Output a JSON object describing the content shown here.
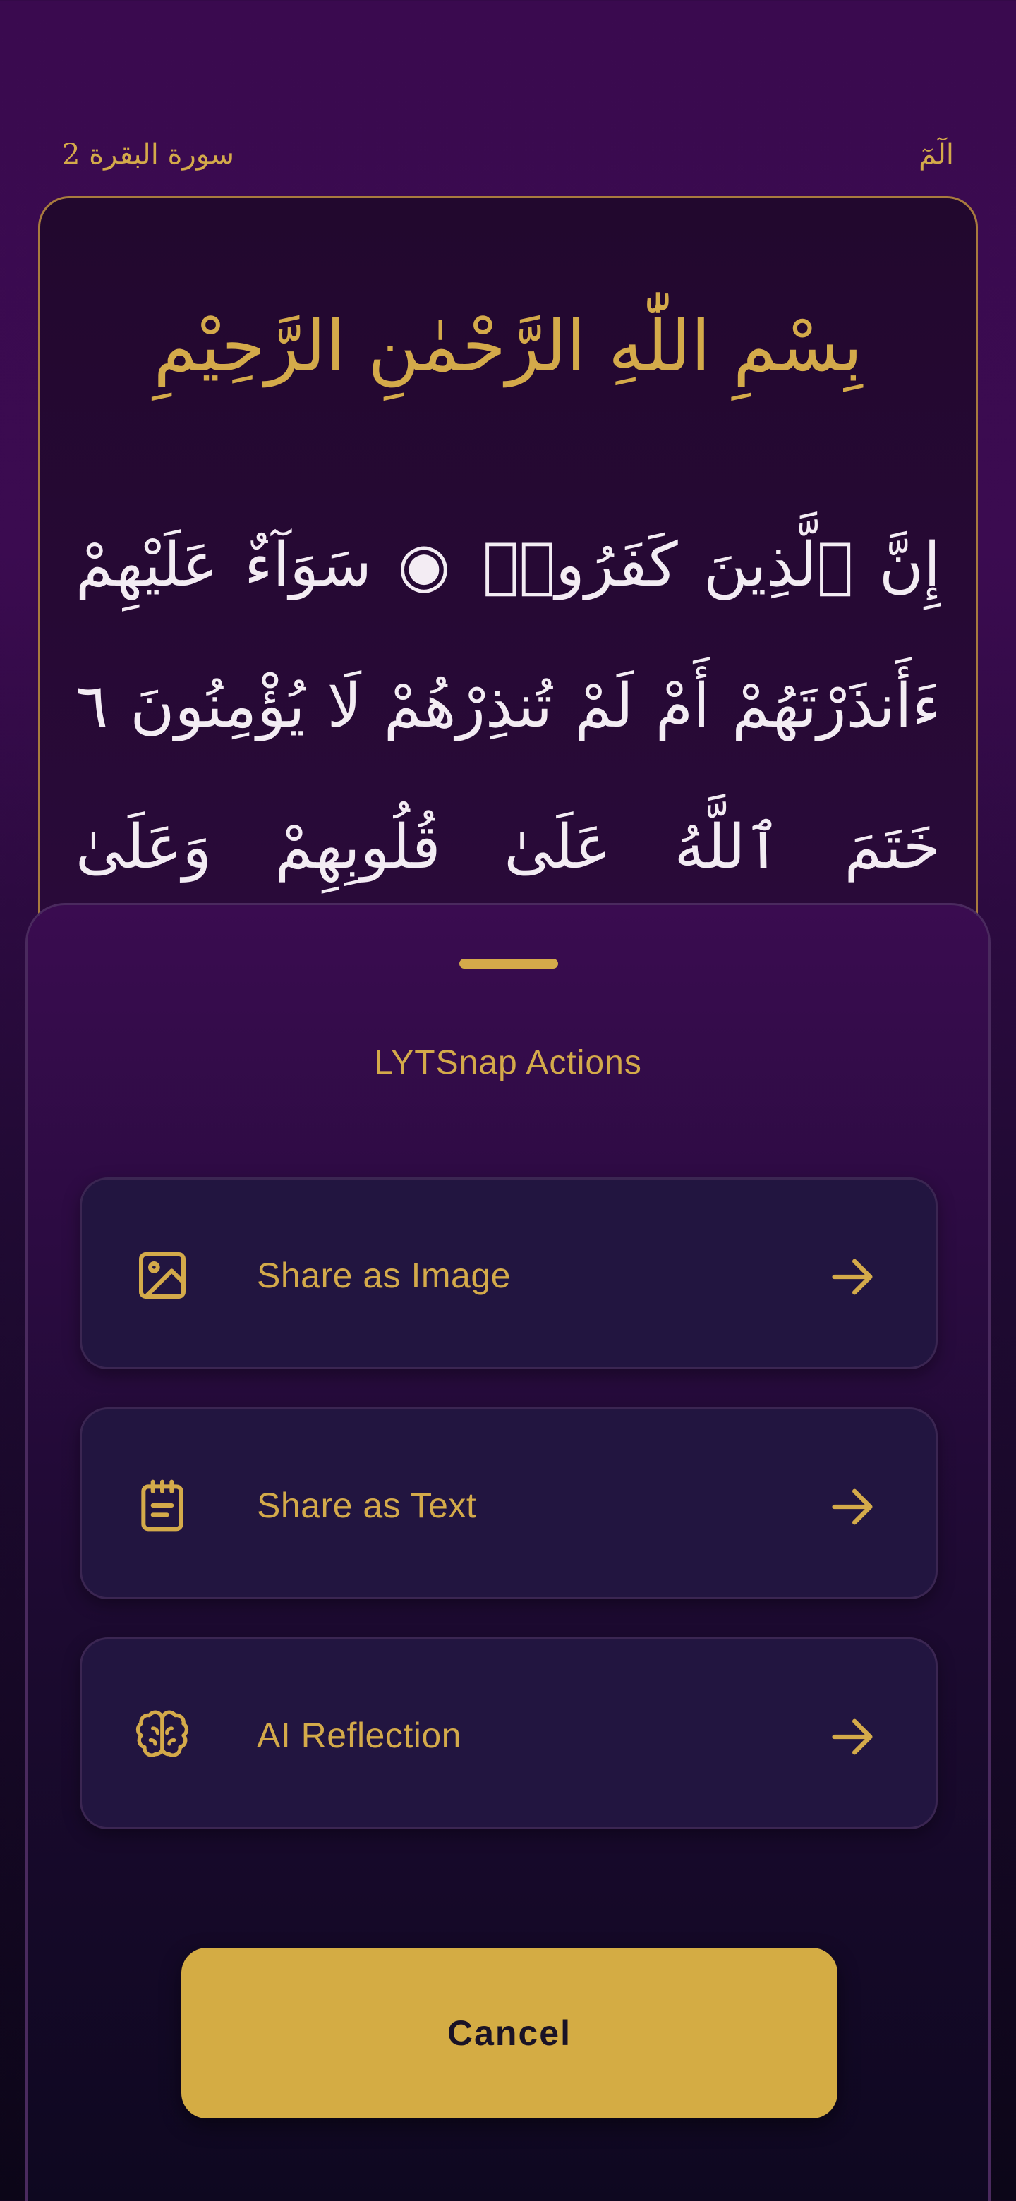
{
  "header": {
    "surah_name": "سورة البقرة 2",
    "juz_name": "الٓمٓ"
  },
  "verse_card": {
    "basmala": "بِسْمِ اللّٰهِ الرَّحْمٰنِ الرَّحِيْمِ",
    "lines": [
      "إِنَّ ٱلَّذِينَ كَفَرُوا۟ ◉ سَوَآءٌ عَلَيْهِمْ",
      "ءَأَنذَرْتَهُمْ أَمْ لَمْ تُنذِرْهُمْ لَا يُؤْمِنُونَ ٦",
      "خَتَمَ ٱللَّهُ عَلَىٰ قُلُوبِهِمْ وَعَلَىٰ"
    ]
  },
  "sheet": {
    "title": "LYTSnap Actions",
    "actions": [
      {
        "label": "Share as Image",
        "icon": "image-icon"
      },
      {
        "label": "Share as Text",
        "icon": "notepad-icon"
      },
      {
        "label": "AI Reflection",
        "icon": "brain-icon"
      }
    ],
    "cancel_label": "Cancel"
  },
  "colors": {
    "accent_gold": "#d4aa4a",
    "background_purple": "#3a0a4f",
    "card_background": "#221540"
  }
}
